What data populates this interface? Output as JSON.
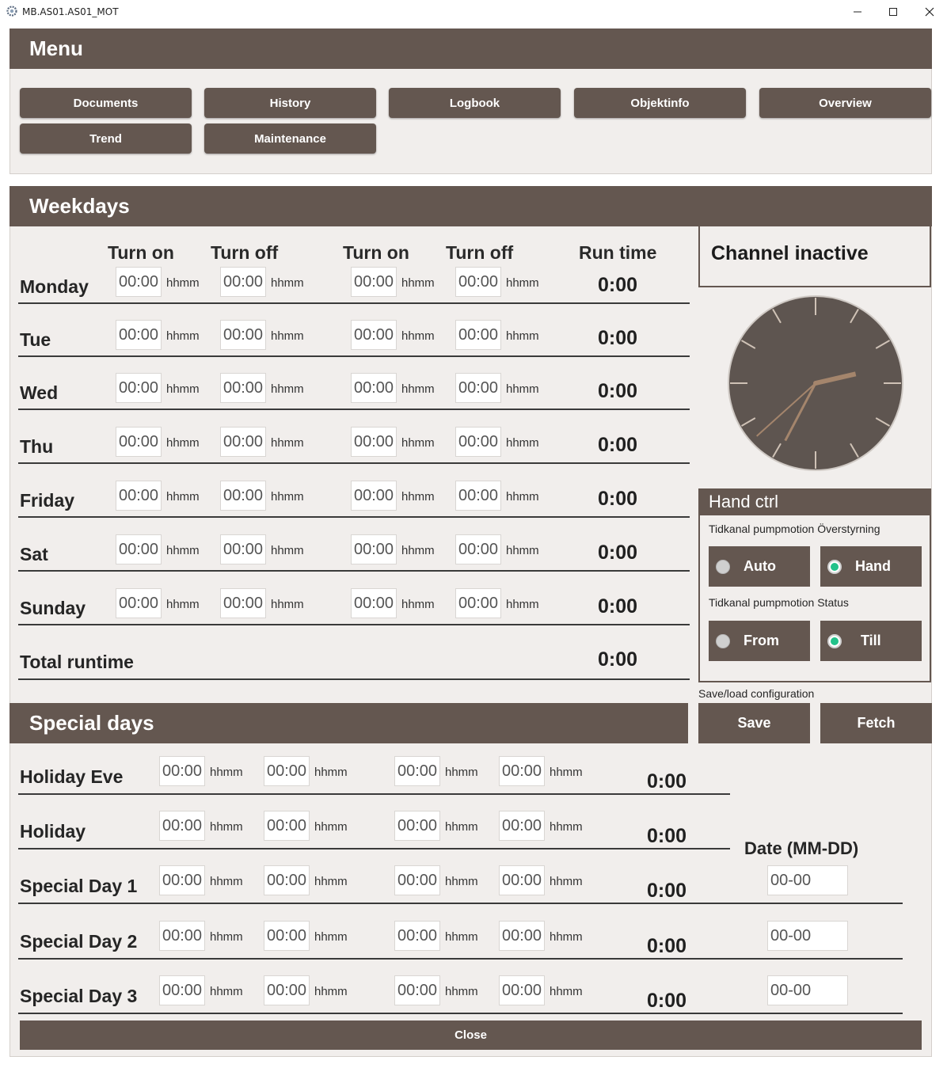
{
  "window": {
    "title": "MB.AS01.AS01_MOT"
  },
  "menu": {
    "title": "Menu",
    "buttons": [
      "Documents",
      "History",
      "Logbook",
      "Objektinfo",
      "Overview",
      "Trend",
      "Maintenance"
    ]
  },
  "weekdays": {
    "title": "Weekdays",
    "columns": [
      "Turn on",
      "Turn off",
      "Turn on",
      "Turn off",
      "Run time"
    ],
    "unit": "hhmm",
    "rows": [
      {
        "label": "Monday",
        "times": [
          "00:00",
          "00:00",
          "00:00",
          "00:00"
        ],
        "runtime": "0:00"
      },
      {
        "label": "Tue",
        "times": [
          "00:00",
          "00:00",
          "00:00",
          "00:00"
        ],
        "runtime": "0:00"
      },
      {
        "label": "Wed",
        "times": [
          "00:00",
          "00:00",
          "00:00",
          "00:00"
        ],
        "runtime": "0:00"
      },
      {
        "label": "Thu",
        "times": [
          "00:00",
          "00:00",
          "00:00",
          "00:00"
        ],
        "runtime": "0:00"
      },
      {
        "label": "Friday",
        "times": [
          "00:00",
          "00:00",
          "00:00",
          "00:00"
        ],
        "runtime": "0:00"
      },
      {
        "label": "Sat",
        "times": [
          "00:00",
          "00:00",
          "00:00",
          "00:00"
        ],
        "runtime": "0:00"
      },
      {
        "label": "Sunday",
        "times": [
          "00:00",
          "00:00",
          "00:00",
          "00:00"
        ],
        "runtime": "0:00"
      }
    ],
    "total_label": "Total runtime",
    "total_value": "0:00"
  },
  "channel": {
    "status": "Channel inactive",
    "clock": {
      "hour": 2,
      "minute": 34,
      "second": 38
    }
  },
  "hand_ctrl": {
    "title": "Hand ctrl",
    "override_label": "Tidkanal pumpmotion Överstyrning",
    "override_options": [
      {
        "label": "Auto",
        "selected": false
      },
      {
        "label": "Hand",
        "selected": true
      }
    ],
    "status_label": "Tidkanal pumpmotion Status",
    "status_options": [
      {
        "label": "From",
        "selected": false
      },
      {
        "label": "Till",
        "selected": true
      }
    ]
  },
  "config": {
    "label": "Save/load configuration",
    "save": "Save",
    "fetch": "Fetch"
  },
  "special_days": {
    "title": "Special days",
    "unit": "hhmm",
    "date_header": "Date (MM-DD)",
    "rows": [
      {
        "label": "Holiday Eve",
        "times": [
          "00:00",
          "00:00",
          "00:00",
          "00:00"
        ],
        "runtime": "0:00"
      },
      {
        "label": "Holiday",
        "times": [
          "00:00",
          "00:00",
          "00:00",
          "00:00"
        ],
        "runtime": "0:00"
      },
      {
        "label": "Special Day 1",
        "times": [
          "00:00",
          "00:00",
          "00:00",
          "00:00"
        ],
        "runtime": "0:00",
        "date": "00-00"
      },
      {
        "label": "Special Day 2",
        "times": [
          "00:00",
          "00:00",
          "00:00",
          "00:00"
        ],
        "runtime": "0:00",
        "date": "00-00"
      },
      {
        "label": "Special Day 3",
        "times": [
          "00:00",
          "00:00",
          "00:00",
          "00:00"
        ],
        "runtime": "0:00",
        "date": "00-00"
      }
    ]
  },
  "close_label": "Close",
  "colors": {
    "header": "#645750",
    "panel": "#f1eeec",
    "accent": "#22c28a",
    "clock_face": "#5e5550",
    "clock_hand": "#a4856c"
  }
}
